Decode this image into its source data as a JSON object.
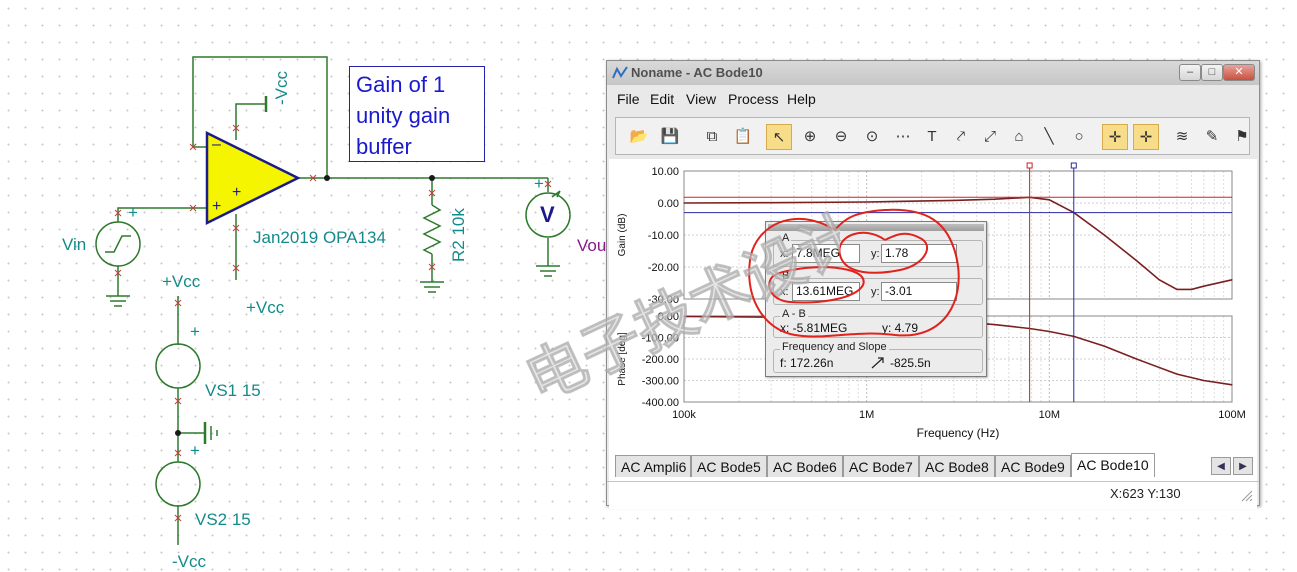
{
  "schematic": {
    "note": {
      "line1": "Gain of 1",
      "line2": "unity gain",
      "line3": "buffer"
    },
    "neg_supply_label": "-Vcc",
    "pos_supply_label": "+Vcc",
    "opamp_label": "Jan2019 OPA134",
    "opamp_minus": "–",
    "opamp_plus": "+",
    "resistor_label": "R2 10k",
    "source_label": "Vin",
    "meter_label": "Vout",
    "meter_letter": "V",
    "vs1_label": "VS1 15",
    "vs2_label": "VS2 15",
    "vs1_top_label": "+Vcc",
    "vs2_bottom_label": "-Vcc",
    "plus_sign": "+"
  },
  "window": {
    "title": "Noname - AC Bode10",
    "buttons": {
      "minimize": "–",
      "maximize": "□",
      "close": "✕"
    },
    "menu": [
      "File",
      "Edit",
      "View",
      "Process",
      "Help"
    ],
    "toolbar_icons": [
      {
        "name": "open-folder-icon",
        "glyph": "📂"
      },
      {
        "name": "save-icon",
        "glyph": "💾"
      },
      {
        "name": "copy-icon",
        "glyph": "⧉"
      },
      {
        "name": "paste-icon",
        "glyph": "📋"
      },
      {
        "name": "pointer-icon",
        "glyph": "↖"
      },
      {
        "name": "zoom-in-icon",
        "glyph": "⊕"
      },
      {
        "name": "zoom-out-icon",
        "glyph": "⊖"
      },
      {
        "name": "zoom-100-icon",
        "glyph": "⊙"
      },
      {
        "name": "grid-icon",
        "glyph": "⋯"
      },
      {
        "name": "text-icon",
        "glyph": "T"
      },
      {
        "name": "marker-icon",
        "glyph": "⤤"
      },
      {
        "name": "marker-slope-icon",
        "glyph": "⤢"
      },
      {
        "name": "label-icon",
        "glyph": "⌂"
      },
      {
        "name": "line-icon",
        "glyph": "╲"
      },
      {
        "name": "circle-icon",
        "glyph": "○"
      },
      {
        "name": "cursor-a-icon",
        "glyph": "✛"
      },
      {
        "name": "cursor-b-icon",
        "glyph": "✛"
      },
      {
        "name": "curves-icon",
        "glyph": "≋"
      },
      {
        "name": "probe-icon",
        "glyph": "✎"
      },
      {
        "name": "flag-icon",
        "glyph": "⚑"
      }
    ],
    "tabs": [
      "AC Ampli6",
      "AC Bode5",
      "AC Bode6",
      "AC Bode7",
      "AC Bode8",
      "AC Bode9",
      "AC Bode10"
    ],
    "selected_tab": "AC Bode10",
    "status": "X:623  Y:130",
    "scroll_left": "◀",
    "scroll_right": "▶",
    "colors": {
      "trace": "#7b1f1f",
      "cursor_a": "#cc2222",
      "cursor_b": "#2a2aa0",
      "highlight": "#f7dc8a"
    }
  },
  "cursor_panel": {
    "a_title": "A",
    "a_x_label": "x:",
    "a_x": "7.8MEG",
    "a_y_label": "y:",
    "a_y": "1.78",
    "b_title": "B",
    "b_x_label": "x:",
    "b_x": "13.61MEG",
    "b_y_label": "y:",
    "b_y": "-3.01",
    "ab_title": "A - B",
    "ab_x": "x:  -5.81MEG",
    "ab_y": "y: 4.79",
    "fs_title": "Frequency and Slope",
    "f": "f:  172.26n",
    "slope": "-825.5n"
  },
  "watermark": "电子技术设计",
  "chart_data": [
    {
      "type": "line",
      "title": "",
      "xlabel": "Frequency (Hz)",
      "ylabel": "Gain (dB)",
      "x_scale": "log",
      "xlim": [
        100000,
        100000000
      ],
      "ylim": [
        -30,
        10
      ],
      "x_tick_labels": [
        "100k",
        "1M",
        "10M",
        "100M"
      ],
      "y_tick_labels": [
        "10.00",
        "0.00",
        "-10.00",
        "-20.00",
        "-30.00"
      ],
      "grid": true,
      "series": [
        {
          "x": [
            100000,
            300000,
            1000000,
            3000000,
            5000000,
            7800000,
            10000000,
            13610000,
            20000000,
            30000000,
            40000000,
            50000000,
            60000000,
            70000000,
            100000000
          ],
          "values": [
            0.0,
            0.1,
            0.3,
            0.8,
            1.2,
            1.78,
            1.0,
            -3.01,
            -10.0,
            -18.0,
            -24.0,
            -27.0,
            -27.0,
            -26.0,
            -24.0
          ]
        }
      ],
      "cursors": [
        {
          "name": "A",
          "x": 7800000,
          "y": 1.78
        },
        {
          "name": "B",
          "x": 13610000,
          "y": -3.01
        }
      ]
    },
    {
      "type": "line",
      "title": "",
      "xlabel": "Frequency (Hz)",
      "ylabel": "Phase [deg]",
      "x_scale": "log",
      "xlim": [
        100000,
        100000000
      ],
      "ylim": [
        -400,
        0
      ],
      "x_tick_labels": [
        "100k",
        "1M",
        "10M",
        "100M"
      ],
      "y_tick_labels": [
        "0.00",
        "-100.00",
        "-200.00",
        "-300.00",
        "-400.00"
      ],
      "grid": true,
      "series": [
        {
          "x": [
            100000,
            300000,
            1000000,
            3000000,
            5000000,
            7800000,
            10000000,
            13610000,
            20000000,
            30000000,
            50000000,
            70000000,
            100000000
          ],
          "values": [
            -2,
            -5,
            -10,
            -25,
            -40,
            -58,
            -72,
            -95,
            -140,
            -200,
            -270,
            -300,
            -320
          ]
        }
      ]
    }
  ]
}
